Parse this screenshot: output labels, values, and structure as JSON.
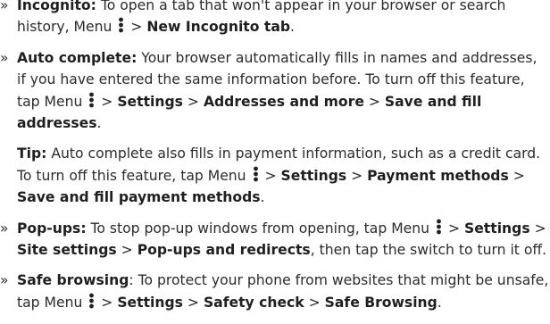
{
  "menu_icon": "more-vertical-icon",
  "bullet_mark": "»",
  "sep": ">",
  "incognito": {
    "title": "Incognito:",
    "t1": "To open a tab that won't appear in your browser or search history, Menu",
    "p1": "New Incognito tab",
    "end": "."
  },
  "autocomplete": {
    "title": "Auto complete:",
    "t1": "Your browser automatically fills in names and addresses, if you have entered the same information before. To turn off this feature, tap Menu",
    "p1": "Settings",
    "p2": "Addresses and more",
    "p3": "Save and fill addresses",
    "end": "."
  },
  "tip": {
    "title": "Tip:",
    "t1": "Auto complete also fills in payment information, such as a credit card. To turn off this feature, tap Menu",
    "p1": "Settings",
    "p2": "Payment methods",
    "p3": "Save and fill payment methods",
    "end": "."
  },
  "popups": {
    "title": "Pop-ups:",
    "t1": "To stop pop-up windows from opening, tap Menu",
    "p1": "Settings",
    "p2": "Site settings",
    "p3": "Pop-ups and redirects",
    "t2": ", then tap the switch to turn it off."
  },
  "safe": {
    "title": "Safe browsing",
    "t1": ": To protect your phone from websites that might be unsafe, tap Menu",
    "p1": "Settings",
    "p2": "Safety check",
    "p3": "Safe Browsing",
    "end": "."
  }
}
